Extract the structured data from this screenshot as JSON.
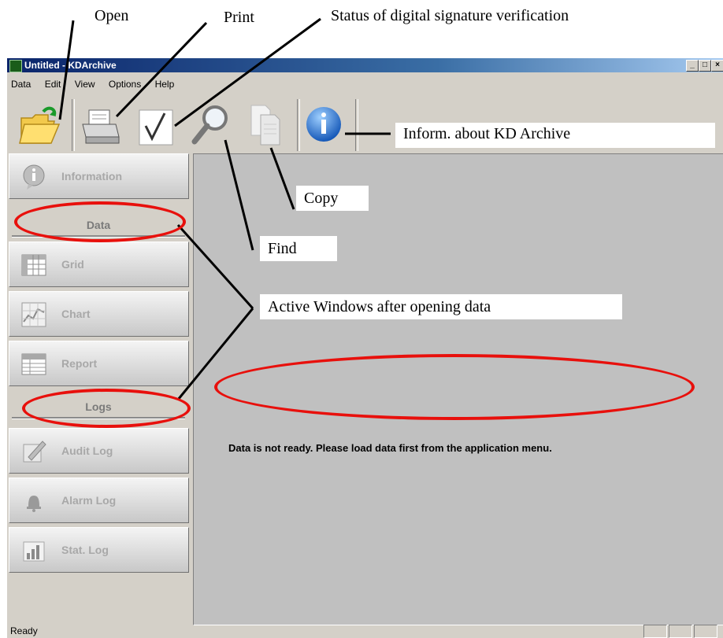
{
  "window": {
    "title": "Untitled - KDArchive",
    "min": "_",
    "max": "□",
    "close": "×"
  },
  "menu": [
    "Data",
    "Edit",
    "View",
    "Options",
    "Help"
  ],
  "toolbar": {
    "open": "open-folder-icon",
    "print": "printer-icon",
    "verify": "checkmark-icon",
    "find": "magnifier-icon",
    "copy": "copy-pages-icon",
    "info": "info-icon"
  },
  "sidebar": {
    "information": "Information",
    "data_section": "Data",
    "grid": "Grid",
    "chart": "Chart",
    "report": "Report",
    "logs_section": "Logs",
    "audit_log": "Audit Log",
    "alarm_log": "Alarm Log",
    "stat_log": "Stat. Log"
  },
  "main": {
    "message": "Data is not ready. Please load data first from the application menu."
  },
  "status": {
    "text": "Ready"
  },
  "annotations": {
    "open": "Open",
    "print": "Print",
    "signature": "Status of digital signature verification",
    "info": "Inform. about KD Archive",
    "copy": "Copy",
    "find": "Find",
    "active": "Active Windows after opening data"
  },
  "colors": {
    "highlight": "#e8100c",
    "titlebar": "#0a246a",
    "panel": "#d4d0c8",
    "main_bg": "#c0c0c0"
  }
}
